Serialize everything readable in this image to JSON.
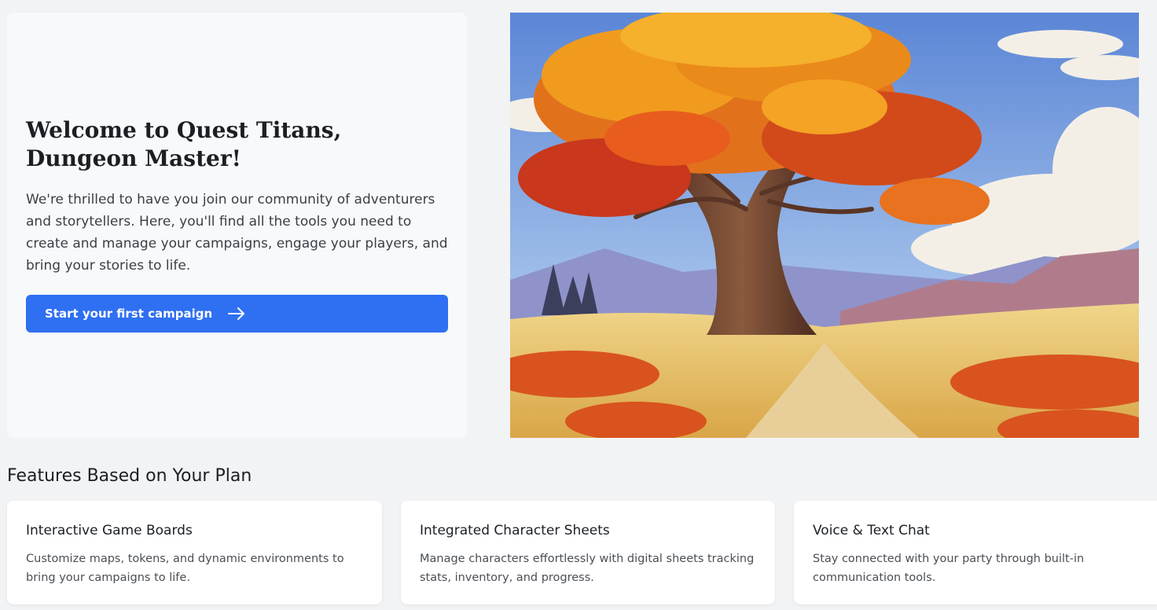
{
  "welcome": {
    "title": "Welcome to Quest Titans, Dungeon Master!",
    "text": "We're thrilled to have you join our community of adventurers and storytellers. Here, you'll find all the tools you need to create and manage your campaigns, engage your players, and bring your stories to life.",
    "cta_label": "Start your first campaign",
    "cta_icon": "arrow-right-icon"
  },
  "hero": {
    "image": "autumn-tree-landscape-illustration"
  },
  "features": {
    "heading": "Features Based on Your Plan",
    "items": [
      {
        "title": "Interactive Game Boards",
        "description": "Customize maps, tokens, and dynamic environments to bring your campaigns to life."
      },
      {
        "title": "Integrated Character Sheets",
        "description": "Manage characters effortlessly with digital sheets tracking stats, inventory, and progress."
      },
      {
        "title": "Voice & Text Chat",
        "description": "Stay connected with your party through built-in communication tools."
      }
    ]
  },
  "colors": {
    "accent": "#2f6ff2",
    "page_bg": "#f2f3f5",
    "card_bg": "#ffffff"
  }
}
